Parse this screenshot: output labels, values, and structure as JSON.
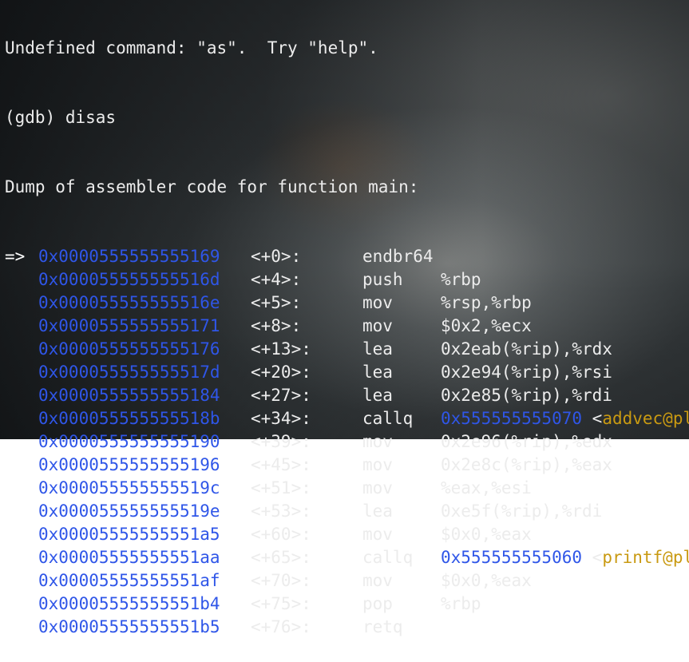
{
  "terminal": {
    "pre_lines": [
      "Undefined command: \"as\".  Try \"help\".",
      "(gdb) disas",
      "Dump of assembler code for function main:"
    ],
    "arrow": "=>",
    "instructions": [
      {
        "addr": "0x0000555555555169",
        "off": "<+0>:",
        "mn": "endbr64",
        "ops": "",
        "target": "",
        "sym": ""
      },
      {
        "addr": "0x000055555555516d",
        "off": "<+4>:",
        "mn": "push",
        "ops": "%rbp",
        "target": "",
        "sym": ""
      },
      {
        "addr": "0x000055555555516e",
        "off": "<+5>:",
        "mn": "mov",
        "ops": "%rsp,%rbp",
        "target": "",
        "sym": ""
      },
      {
        "addr": "0x0000555555555171",
        "off": "<+8>:",
        "mn": "mov",
        "ops": "$0x2,%ecx",
        "target": "",
        "sym": ""
      },
      {
        "addr": "0x0000555555555176",
        "off": "<+13>:",
        "mn": "lea",
        "ops": "0x2eab(%rip),%rdx",
        "target": "",
        "sym": ""
      },
      {
        "addr": "0x000055555555517d",
        "off": "<+20>:",
        "mn": "lea",
        "ops": "0x2e94(%rip),%rsi",
        "target": "",
        "sym": ""
      },
      {
        "addr": "0x0000555555555184",
        "off": "<+27>:",
        "mn": "lea",
        "ops": "0x2e85(%rip),%rdi",
        "target": "",
        "sym": ""
      },
      {
        "addr": "0x000055555555518b",
        "off": "<+34>:",
        "mn": "callq",
        "ops": "",
        "target": "0x555555555070",
        "sym": "addvec@plt>"
      },
      {
        "addr": "0x0000555555555190",
        "off": "<+39>:",
        "mn": "mov",
        "ops": "0x2e96(%rip),%edx",
        "target": "",
        "sym": ""
      },
      {
        "addr": "0x0000555555555196",
        "off": "<+45>:",
        "mn": "mov",
        "ops": "0x2e8c(%rip),%eax",
        "target": "",
        "sym": ""
      },
      {
        "addr": "0x000055555555519c",
        "off": "<+51>:",
        "mn": "mov",
        "ops": "%eax,%esi",
        "target": "",
        "sym": ""
      },
      {
        "addr": "0x000055555555519e",
        "off": "<+53>:",
        "mn": "lea",
        "ops": "0xe5f(%rip),%rdi",
        "target": "",
        "sym": ""
      },
      {
        "addr": "0x00005555555551a5",
        "off": "<+60>:",
        "mn": "mov",
        "ops": "$0x0,%eax",
        "target": "",
        "sym": ""
      },
      {
        "addr": "0x00005555555551aa",
        "off": "<+65>:",
        "mn": "callq",
        "ops": "",
        "target": "0x555555555060",
        "sym": "printf@plt>"
      },
      {
        "addr": "0x00005555555551af",
        "off": "<+70>:",
        "mn": "mov",
        "ops": "$0x0,%eax",
        "target": "",
        "sym": ""
      },
      {
        "addr": "0x00005555555551b4",
        "off": "<+75>:",
        "mn": "pop",
        "ops": "%rbp",
        "target": "",
        "sym": ""
      },
      {
        "addr": "0x00005555555551b5",
        "off": "<+76>:",
        "mn": "retq",
        "ops": "",
        "target": "",
        "sym": ""
      }
    ]
  },
  "colors": {
    "address": "#2f56e8",
    "symbol": "#c99a12",
    "text": "#ececec"
  }
}
